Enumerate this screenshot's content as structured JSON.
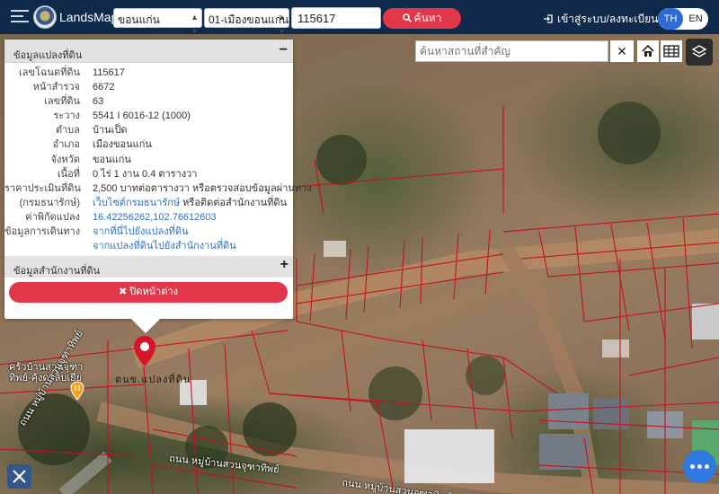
{
  "app": {
    "brand": "LandsMaps",
    "province_select": "ขอนแก่น",
    "district_select": "01-เมืองขอนแก่น",
    "parcel_query": "115617",
    "search_label": "ค้นหา",
    "login_label": "เข้าสู่ระบบ/ลงทะเบียน",
    "lang_th": "TH",
    "lang_en": "EN"
  },
  "map_tools": {
    "landmark_placeholder": "ค้นหาสถานที่สำคัญ"
  },
  "panel": {
    "title": "ข้อมูลแปลงที่ดิน",
    "collapse_symbol": "−",
    "rows": [
      {
        "label": "เลขโฉนดที่ดิน",
        "value": "115617"
      },
      {
        "label": "หน้าสำรวจ",
        "value": "6672"
      },
      {
        "label": "เลขที่ดิน",
        "value": "63"
      },
      {
        "label": "ระวาง",
        "value": "5541 I 6016-12 (1000)"
      },
      {
        "label": "ตำบล",
        "value": "บ้านเป็ด"
      },
      {
        "label": "อำเภอ",
        "value": "เมืองขอนแก่น"
      },
      {
        "label": "จังหวัด",
        "value": "ขอนแก่น"
      },
      {
        "label": "เนื้อที่",
        "value": "0 ไร่ 1 งาน 0.4 ตารางวา"
      },
      {
        "label": "ราคาประเมินที่ดิน",
        "value": "2,500 บาทต่อตารางวา หรือตรวจสอบข้อมูลผ่านทาง"
      },
      {
        "label": "(กรมธนารักษ์)",
        "value_link": "เว็บไซต์กรมธนารักษ์",
        "value_rest": " หรือติดต่อสำนักงานที่ดิน"
      },
      {
        "label": "ค่าพิกัดแปลง",
        "value": "16.42256262,102.76612603"
      },
      {
        "label": "ข้อมูลการเดินทาง",
        "value": "จากที่นี่ไปยังแปลงที่ดิน"
      },
      {
        "label": "",
        "value": "จากแปลงที่ดินไปยังสำนักงานที่ดิน"
      }
    ],
    "office_title": "ข้อมูลสำนักงานที่ดิน",
    "expand_symbol": "+",
    "close_label": "✖ ปิดหน้าต่าง"
  },
  "map_labels": {
    "parcel_marker": "ตนข.แปลงที่ดิน",
    "poi_line1": "ครัวบ้านสวนจุฑา",
    "poi_line2": "ทิพย์-คุ้งดาลิบเยี่ย",
    "road_main": "ถนน หมู่บ้านสวนจุฑาทิพย์",
    "road_side": "ถนน หมู่บ้านสวนจุฑาทิพย์",
    "road_bottom": "ถนน หมู่บ้านสวนจุฑาทิพย์"
  },
  "colors": {
    "topbar": "#102a4c",
    "accent_red": "#e2364a",
    "parcel_line": "#c8101e",
    "fab_blue": "#2f79e0"
  }
}
